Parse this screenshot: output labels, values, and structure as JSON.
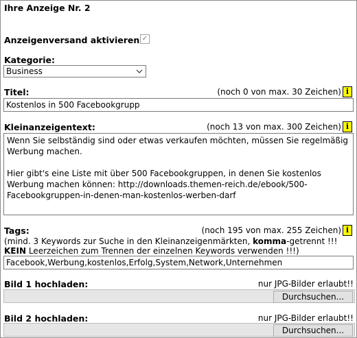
{
  "title": "Ihre Anzeige Nr. 2",
  "activate": {
    "label": "Anzeigenversand aktivieren:",
    "checked": true
  },
  "category": {
    "label": "Kategorie:",
    "value": "Business"
  },
  "titel": {
    "label": "Titel:",
    "counter": "(noch 0 von max. 30 Zeichen)",
    "value": "Kostenlos in 500 Facebookgrupp"
  },
  "text": {
    "label": "Kleinanzeigentext:",
    "counter": "(noch 13 von max. 300 Zeichen)",
    "value": "Wenn Sie selbständig sind oder etwas verkaufen möchten, müssen Sie regelmäßig Werbung machen.\n\nHier gibt's eine Liste mit über 500 Facebookgruppen, in denen Sie kostenlos Werbung machen können: http://downloads.themen-reich.de/ebook/500-Facebookgruppen-in-denen-man-kostenlos-werben-darf"
  },
  "tags": {
    "label": "Tags:",
    "counter": "(noch 195 von max. 255 Zeichen)",
    "hint1_pre": "(mind. 3 Keywords zur Suche in den Kleinanzeigenmärkten, ",
    "hint1_bold": "komma",
    "hint1_post": "-getrennt !!!",
    "hint2_bold": "KEIN",
    "hint2_post": " Leerzeichen zum Trennen der einzelnen Keywords verwenden !!!)",
    "value": "Facebook,Werbung,kostenlos,Erfolg,System,Network,Unternehmen"
  },
  "info_glyph": "i",
  "upload1": {
    "label": "Bild 1 hochladen:",
    "note": "nur JPG-Bilder erlaubt!!",
    "button": "Durchsuchen..."
  },
  "upload2": {
    "label": "Bild 2 hochladen:",
    "note": "nur JPG-Bilder erlaubt!!",
    "button": "Durchsuchen..."
  }
}
